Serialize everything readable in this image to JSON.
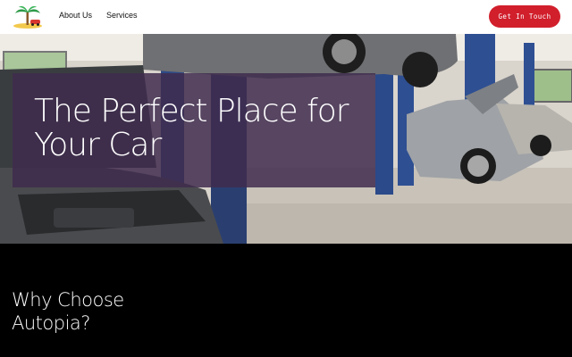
{
  "header": {
    "logo_icon": "palm-tree-car-logo",
    "nav": [
      {
        "label": "About Us"
      },
      {
        "label": "Services"
      }
    ],
    "cta_label": "Get In Touch",
    "cta_color": "#d11f2c"
  },
  "hero": {
    "title": "The Perfect Place for Your Car",
    "overlay_color": "#402c4e",
    "image": "auto-repair-garage-photo"
  },
  "why": {
    "title": "Why Choose Autopia?"
  }
}
